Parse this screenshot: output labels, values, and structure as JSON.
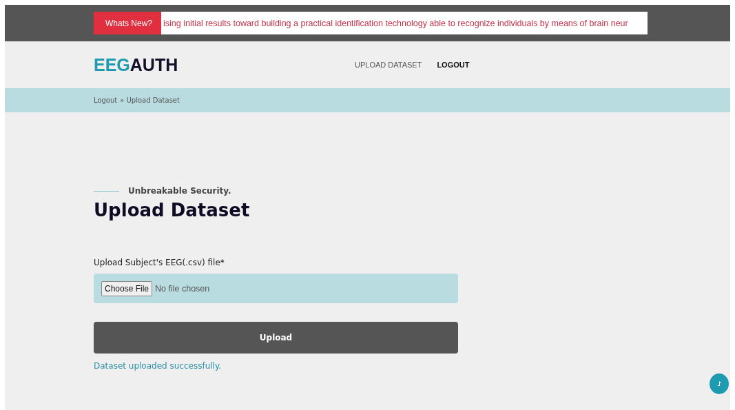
{
  "ticker": {
    "badge": "Whats New?",
    "text": "ising initial results toward building a practical identification technology able to recognize individuals by means of brain neur"
  },
  "header": {
    "logo": [
      {
        "text": "EEG",
        "kind": "accent"
      },
      {
        "text": "AUTH",
        "kind": "plain"
      }
    ],
    "nav": [
      {
        "label": "UPLOAD DATASET",
        "selected": false
      },
      {
        "label": "LOGOUT",
        "selected": true
      }
    ]
  },
  "breadcrumb": [
    "Logout",
    "» Upload Dataset"
  ],
  "section": {
    "tagline": "Unbreakable Security.",
    "title": "Upload Dataset"
  },
  "form": {
    "label": "Upload Subject's EEG(.csv) file*",
    "choose_button": "Choose File",
    "file_status": "No file chosen",
    "submit": "Upload",
    "message": "Dataset uploaded successfully."
  }
}
